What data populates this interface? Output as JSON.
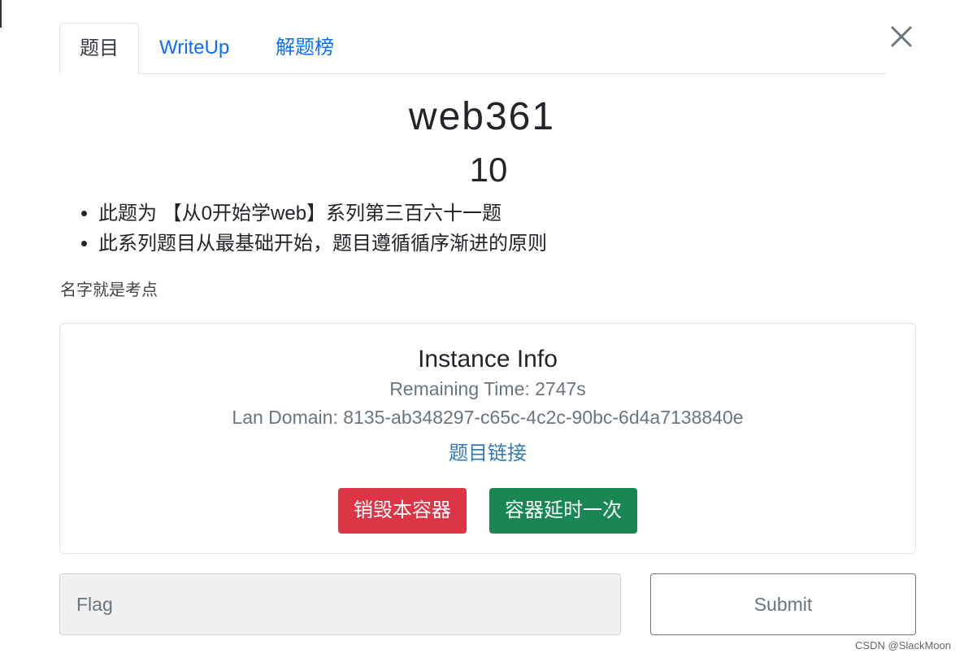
{
  "tabs": [
    {
      "label": "题目",
      "active": true
    },
    {
      "label": "WriteUp",
      "active": false
    },
    {
      "label": "解题榜",
      "active": false
    }
  ],
  "close_icon": "close-icon",
  "challenge": {
    "title": "web361",
    "points": "10",
    "description": [
      "此题为 【从0开始学web】系列第三百六十一题",
      "此系列题目从最基础开始，题目遵循循序渐进的原则"
    ],
    "hint": "名字就是考点"
  },
  "instance": {
    "title": "Instance Info",
    "remaining_time": "Remaining Time: 2747s",
    "lan_domain": "Lan Domain: 8135-ab348297-c65c-4c2c-90bc-6d4a7138840e",
    "link_label": "题目链接",
    "destroy_label": "销毁本容器",
    "extend_label": "容器延时一次"
  },
  "flag_form": {
    "placeholder": "Flag",
    "value": "",
    "submit_label": "Submit"
  },
  "watermark": "CSDN @SlackMoon",
  "colors": {
    "tab_link": "#0d6efd",
    "danger": "#dc3545",
    "success": "#198754",
    "link": "#337ab7",
    "muted": "#6c757d"
  }
}
